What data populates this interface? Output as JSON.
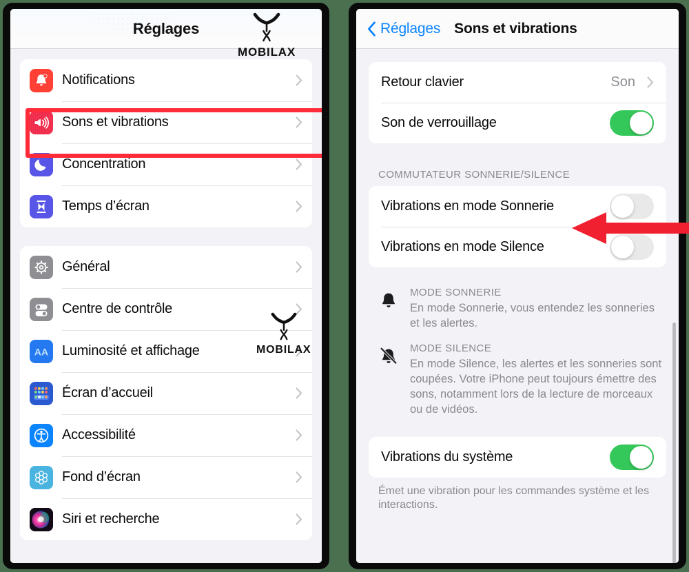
{
  "watermark": {
    "brand": "MOBILAX"
  },
  "left_phone": {
    "nav": {
      "title": "Réglages"
    },
    "groups": [
      {
        "rows": [
          {
            "label": "Notifications",
            "icon": "bell-icon",
            "icon_bg": "#ff3b30",
            "highlighted": false
          },
          {
            "label": "Sons et vibrations",
            "icon": "speaker-waves-icon",
            "icon_bg": "#f02a4b",
            "highlighted": true
          },
          {
            "label": "Concentration",
            "icon": "moon-icon",
            "icon_bg": "#5856e6",
            "highlighted": false
          },
          {
            "label": "Temps d’écran",
            "icon": "hourglass-icon",
            "icon_bg": "#5856e6",
            "highlighted": false
          }
        ]
      },
      {
        "rows": [
          {
            "label": "Général",
            "icon": "gear-icon",
            "icon_bg": "#8e8e93",
            "highlighted": false
          },
          {
            "label": "Centre de contrôle",
            "icon": "toggles-icon",
            "icon_bg": "#8e8e93",
            "highlighted": false
          },
          {
            "label": "Luminosité et affichage",
            "icon": "aa-text-icon",
            "icon_bg": "#2479f0",
            "highlighted": false
          },
          {
            "label": "Écran d’accueil",
            "icon": "app-grid-icon",
            "icon_bg": "#2b5ad0",
            "highlighted": false
          },
          {
            "label": "Accessibilité",
            "icon": "accessibility-icon",
            "icon_bg": "#0a84ff",
            "highlighted": false
          },
          {
            "label": "Fond d’écran",
            "icon": "flower-wallpaper-icon",
            "icon_bg": "#4ab4e0",
            "highlighted": false
          },
          {
            "label": "Siri et recherche",
            "icon": "siri-orb-icon",
            "icon_bg": "#2a1a2e",
            "highlighted": false
          }
        ]
      }
    ],
    "chevron_label": "chevron-right"
  },
  "right_phone": {
    "nav": {
      "back_label": "Réglages",
      "title": "Sons et vibrations"
    },
    "group_top": {
      "rows": [
        {
          "label": "Retour clavier",
          "type": "value",
          "value": "Son"
        },
        {
          "label": "Son de verrouillage",
          "type": "switch",
          "on": true
        }
      ]
    },
    "ring_silent_section": {
      "header": "COMMUTATEUR SONNERIE/SILENCE",
      "rows": [
        {
          "label": "Vibrations en mode Sonnerie",
          "type": "switch",
          "on": false
        },
        {
          "label": "Vibrations en mode Silence",
          "type": "switch",
          "on": false
        }
      ]
    },
    "explainers": [
      {
        "icon": "bell-icon",
        "title": "MODE SONNERIE",
        "desc": "En mode Sonnerie, vous entendez les sonneries et les alertes."
      },
      {
        "icon": "bell-slash-icon",
        "title": "MODE SILENCE",
        "desc": "En mode Silence, les alertes et les sonneries sont coupées. Votre iPhone peut toujours émettre des sons, notamment lors de la lecture de morceaux ou de vidéos."
      }
    ],
    "group_bottom": {
      "rows": [
        {
          "label": "Vibrations du système",
          "type": "switch",
          "on": true
        }
      ],
      "footer": "Émet une vibration pour les commandes système et les interactions."
    }
  },
  "annotations": {
    "highlight_color": "#ff2b38",
    "arrow_color": "#f02030",
    "highlight_target": "Sons et vibrations",
    "arrow_target": "Vibrations en mode Sonnerie / Silence"
  }
}
